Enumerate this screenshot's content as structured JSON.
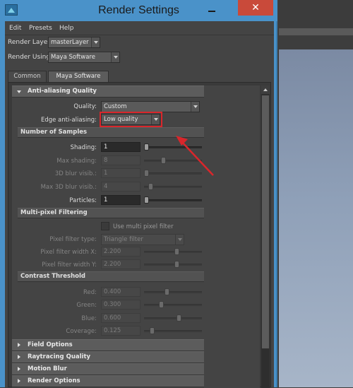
{
  "window": {
    "title": "Render Settings",
    "minimize_glyph": "",
    "close_glyph": "✕"
  },
  "menu": [
    "Edit",
    "Presets",
    "Help"
  ],
  "render_layer": {
    "label": "Render Layer",
    "value": "masterLayer"
  },
  "render_using": {
    "label": "Render Using",
    "value": "Maya Software"
  },
  "tabs": [
    {
      "label": "Common",
      "active": false
    },
    {
      "label": "Maya Software",
      "active": true
    }
  ],
  "anti_aliasing": {
    "title": "Anti-aliasing Quality",
    "quality_label": "Quality:",
    "quality_value": "Custom",
    "edge_label": "Edge anti-aliasing:",
    "edge_value": "Low quality"
  },
  "number_of_samples": {
    "title": "Number of Samples",
    "fields": [
      {
        "label": "Shading:",
        "value": "1",
        "enabled": true,
        "slider": 0.0
      },
      {
        "label": "Max shading:",
        "value": "8",
        "enabled": false,
        "slider": 0.3
      },
      {
        "label": "3D blur visib.:",
        "value": "1",
        "enabled": false,
        "slider": 0.0
      },
      {
        "label": "Max 3D blur visib.:",
        "value": "4",
        "enabled": false,
        "slider": 0.08
      },
      {
        "label": "Particles:",
        "value": "1",
        "enabled": true,
        "slider": 0.0
      }
    ]
  },
  "multi_pixel": {
    "title": "Multi-pixel Filtering",
    "checkbox_label": "Use multi pixel filter",
    "filter_type_label": "Pixel filter type:",
    "filter_type_value": "Triangle filter",
    "width_x_label": "Pixel filter width X:",
    "width_x_value": "2.200",
    "width_y_label": "Pixel filter width Y:",
    "width_y_value": "2.200",
    "width_x_slider": 0.58,
    "width_y_slider": 0.58
  },
  "contrast": {
    "title": "Contrast Threshold",
    "fields": [
      {
        "label": "Red:",
        "value": "0.400",
        "slider": 0.4
      },
      {
        "label": "Green:",
        "value": "0.300",
        "slider": 0.3
      },
      {
        "label": "Blue:",
        "value": "0.600",
        "slider": 0.6
      },
      {
        "label": "Coverage:",
        "value": "0.125",
        "slider": 0.125
      }
    ]
  },
  "collapsed_sections": [
    "Field Options",
    "Raytracing Quality",
    "Motion Blur",
    "Render Options"
  ],
  "colors": {
    "highlight": "#d9262b",
    "title_bar": "#4a92c9",
    "close": "#c94a3a"
  }
}
